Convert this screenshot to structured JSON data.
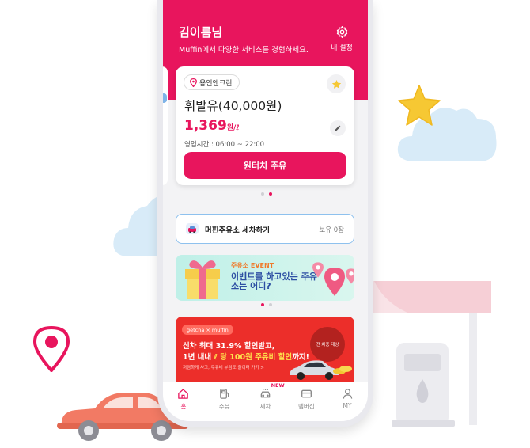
{
  "header": {
    "user_name": "김이름님",
    "welcome": "Muffin에서 다양한 서비스를 경험하세요.",
    "settings_label": "내 설정"
  },
  "station_card": {
    "location": "용인엔크린",
    "fuel": "휘발유(40,000원)",
    "price": "1,369",
    "price_unit": "원/ℓ",
    "hours": "영업시간 : 06:00 ~ 22:00",
    "order_label": "원터치 주유",
    "favorite": true,
    "carousel_dots": 2,
    "carousel_active": 2
  },
  "wash": {
    "label": "머핀주유소 세차하기",
    "count": "보유 0장"
  },
  "event_banner": {
    "tag": "주유소 EVENT",
    "title": "이벤트를 하고있는 주유소는 어디?",
    "carousel_dots": 2,
    "carousel_active": 1
  },
  "promo_banner": {
    "brand": "getcha × muffin",
    "line1": "신차 최대 31.9% 할인받고,",
    "line2_pre": "1년 내내 ",
    "line2_hl": "ℓ 당 100원 주유비 할인",
    "line2_post": "까지!",
    "note": "저렴하게 사고, 주유비 부담도 줄이러 가기  >",
    "badge": "전 차종 대상"
  },
  "tabbar": {
    "items": [
      {
        "label": "홈",
        "icon": "home-icon",
        "active": true
      },
      {
        "label": "주유",
        "icon": "fuel-pump-icon",
        "active": false
      },
      {
        "label": "세차",
        "icon": "car-wash-icon",
        "active": false,
        "badge": "NEW"
      },
      {
        "label": "멤버십",
        "icon": "membership-card-icon",
        "active": false
      },
      {
        "label": "MY",
        "icon": "person-icon",
        "active": false
      }
    ]
  },
  "colors": {
    "brand": "#e8155d",
    "background": "#f3f3f5",
    "promo": "#ec2e2a",
    "event": "#bff0e8"
  }
}
